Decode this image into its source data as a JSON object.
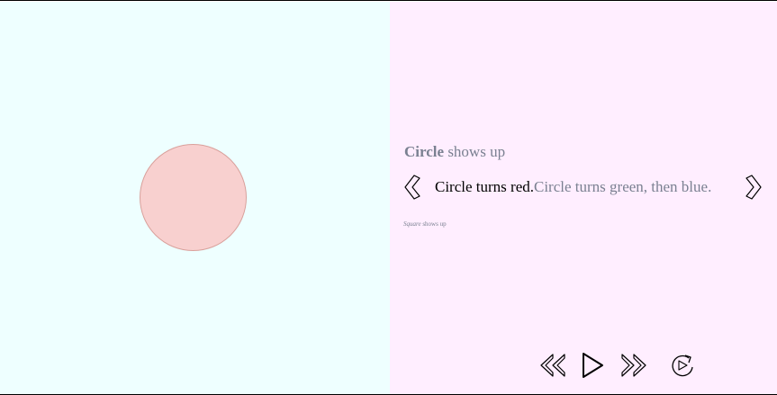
{
  "colors": {
    "stage_bg": "#eeffff",
    "panel_bg": "#ffeeff",
    "circle_fill": "#f8d0cf",
    "circle_stroke": "#d9a09b",
    "muted_text": "#7a8091"
  },
  "stage": {
    "shape": "circle",
    "shape_fill": "#f8d0cf"
  },
  "narration": {
    "previous": {
      "subject": "Circle",
      "rest": " shows up"
    },
    "current": "Circle turns red.",
    "next_inline": "Circle turns green, then blue.",
    "next": {
      "subject": "Square",
      "rest": " shows up"
    }
  },
  "icons": {
    "prev": "chevron-left-icon",
    "next": "chevron-right-icon",
    "rewind": "rewind-icon",
    "play": "play-icon",
    "fast_forward": "fast-forward-icon",
    "replay": "replay-icon"
  }
}
